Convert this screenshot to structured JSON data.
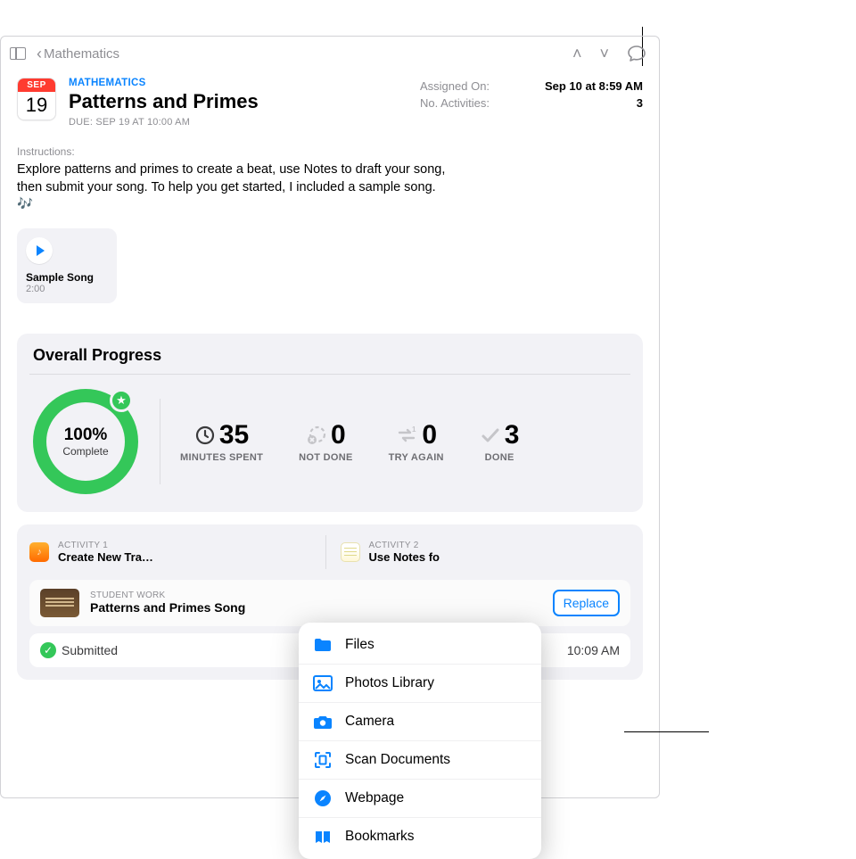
{
  "nav": {
    "back_label": "Mathematics"
  },
  "header": {
    "cal_month": "SEP",
    "cal_day": "19",
    "eyebrow": "MATHEMATICS",
    "title": "Patterns and Primes",
    "due": "DUE: SEP 19 AT 10:00 AM",
    "meta": {
      "assigned_label": "Assigned On:",
      "assigned_value": "Sep 10 at 8:59 AM",
      "activities_label": "No. Activities:",
      "activities_value": "3"
    }
  },
  "instructions": {
    "label": "Instructions:",
    "body": "Explore patterns and primes to create a beat, use Notes to draft your song, then submit your song. To help you get started, I included a sample song. 🎶"
  },
  "attachment": {
    "name": "Sample Song",
    "duration": "2:00"
  },
  "progress": {
    "heading": "Overall Progress",
    "percent": "100%",
    "percent_label": "Complete",
    "stats": {
      "minutes_value": "35",
      "minutes_label": "MINUTES SPENT",
      "notdone_value": "0",
      "notdone_label": "NOT DONE",
      "tryagain_value": "0",
      "tryagain_label": "TRY AGAIN",
      "done_value": "3",
      "done_label": "DONE"
    }
  },
  "activities": {
    "a1_over": "ACTIVITY 1",
    "a1_title": "Create New Tra…",
    "a2_over": "ACTIVITY 2",
    "a2_title": "Use Notes fo"
  },
  "work": {
    "over": "STUDENT WORK",
    "title": "Patterns and Primes Song",
    "replace_label": "Replace"
  },
  "status": {
    "text": "Submitted",
    "time_suffix": "10:09 AM"
  },
  "menu": {
    "items": {
      "files": "Files",
      "photos": "Photos Library",
      "camera": "Camera",
      "scan": "Scan Documents",
      "webpage": "Webpage",
      "bookmarks": "Bookmarks"
    }
  }
}
